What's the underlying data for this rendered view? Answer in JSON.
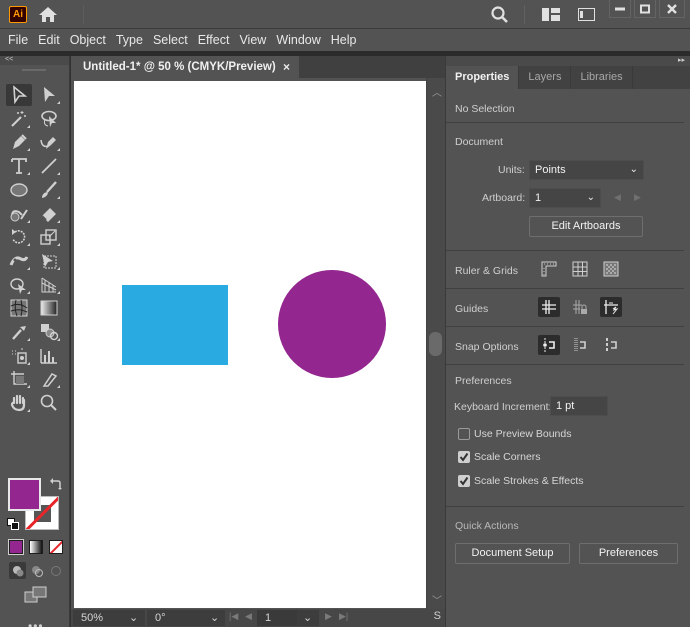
{
  "app": {
    "logo_text": "Ai",
    "icons": [
      "home-icon",
      "search-icon",
      "arrange-documents-icon",
      "workspace-switcher-icon",
      "minimize-icon",
      "maximize-icon",
      "close-icon"
    ]
  },
  "menu": {
    "items": [
      "File",
      "Edit",
      "Object",
      "Type",
      "Select",
      "Effect",
      "View",
      "Window",
      "Help"
    ]
  },
  "toolbar": {
    "collapse_label": "<<",
    "more_label": "•••",
    "tools": [
      "selection-tool",
      "direct-selection-tool",
      "magic-wand-tool",
      "lasso-tool",
      "pen-tool",
      "curvature-tool",
      "type-tool",
      "line-segment-tool",
      "ellipse-tool",
      "paintbrush-tool",
      "shaper-tool",
      "eraser-tool",
      "rotate-tool",
      "scale-tool",
      "puppet-warp-tool",
      "free-transform-tool",
      "shape-builder-tool",
      "perspective-grid-tool",
      "mesh-tool",
      "gradient-tool",
      "eyedropper-tool",
      "blend-tool",
      "symbol-sprayer-tool",
      "column-graph-tool",
      "artboard-tool",
      "slice-tool",
      "hand-tool",
      "zoom-tool"
    ],
    "fill_color": "#93278f",
    "stroke": "none"
  },
  "document": {
    "tab_label": "Untitled-1* @ 50 % (CMYK/Preview)",
    "close_label": "×",
    "shapes": [
      {
        "type": "rectangle",
        "color": "#29abe2"
      },
      {
        "type": "ellipse",
        "color": "#93278f"
      }
    ],
    "status": {
      "zoom": "50%",
      "rotation": "0°",
      "artboard_number": "1",
      "right_label": "S"
    }
  },
  "panel": {
    "collapse_label": "▸▸",
    "tabs": [
      {
        "label": "Properties",
        "active": true
      },
      {
        "label": "Layers",
        "active": false
      },
      {
        "label": "Libraries",
        "active": false
      }
    ],
    "selection_status": "No Selection",
    "document": {
      "heading": "Document",
      "units_label": "Units:",
      "units_value": "Points",
      "artboard_label": "Artboard:",
      "artboard_value": "1",
      "edit_artboards_label": "Edit Artboards"
    },
    "ruler_grids_label": "Ruler & Grids",
    "guides_label": "Guides",
    "snap_options_label": "Snap Options",
    "preferences": {
      "heading": "Preferences",
      "keyboard_increment_label": "Keyboard Increment:",
      "keyboard_increment_value": "1 pt",
      "checkboxes": [
        {
          "label": "Use Preview Bounds",
          "checked": false
        },
        {
          "label": "Scale Corners",
          "checked": true
        },
        {
          "label": "Scale Strokes & Effects",
          "checked": true
        }
      ]
    },
    "quick_actions": {
      "heading": "Quick Actions",
      "document_setup_label": "Document Setup",
      "preferences_label": "Preferences"
    }
  }
}
